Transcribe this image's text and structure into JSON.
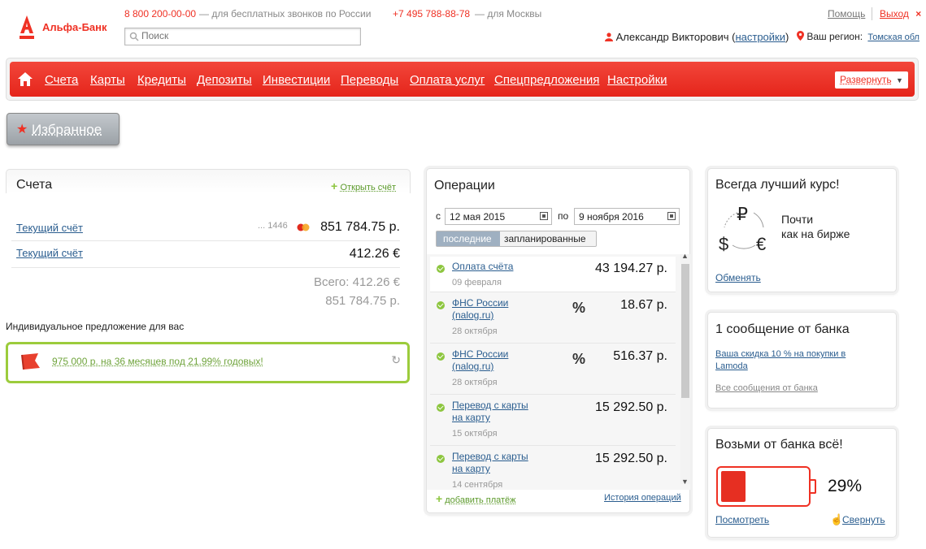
{
  "header": {
    "brand": "Альфа-Банк",
    "phone1": "8 800 200-00-00",
    "phone1_note": "— для бесплатных звонков по России",
    "phone2": "+7 495 788-88-78",
    "phone2_note": "— для Москвы",
    "search_placeholder": "Поиск",
    "help": "Помощь",
    "exit": "Выход",
    "user_name": "Александр Викторович",
    "settings_link": "настройки",
    "region_label": "Ваш регион:",
    "region_value": "Томская обл"
  },
  "nav": {
    "items": [
      "Счета",
      "Карты",
      "Кредиты",
      "Депозиты",
      "Инвестиции",
      "Переводы",
      "Оплата услуг",
      "Спецпредложения",
      "Настройки"
    ],
    "expand": "Развернуть"
  },
  "favorites": {
    "label": "Избранное"
  },
  "accounts": {
    "title": "Счета",
    "open_link": "Открыть счёт",
    "rows": [
      {
        "name": "Текущий счёт",
        "card_mask": "... 1446",
        "amount": "851 784.75 р."
      },
      {
        "name": "Текущий счёт",
        "card_mask": "",
        "amount": "412.26 €"
      }
    ],
    "total_label": "Всего: 412.26 €",
    "total_rub": "851 784.75 р.",
    "offer_heading": "Индивидуальное предложение для вас",
    "offer_text": "975 000 р. на 36 месяцев под 21.99% годовых!"
  },
  "operations": {
    "title": "Операции",
    "from_label": "с",
    "from_date": "12 мая 2015",
    "to_label": "по",
    "to_date": "9 ноября 2016",
    "tabs": [
      "последние",
      "запланированные"
    ],
    "items": [
      {
        "name": "Оплата счёта",
        "date": "09 февраля",
        "amount": "43 194.27 р.",
        "tax": false
      },
      {
        "name": "ФНС России (nalog.ru)",
        "date": "28 октября",
        "amount": "18.67 р.",
        "tax": true
      },
      {
        "name": "ФНС России (nalog.ru)",
        "date": "28 октября",
        "amount": "516.37 р.",
        "tax": true
      },
      {
        "name": "Перевод с карты на карту",
        "date": "15 октября",
        "amount": "15 292.50 р.",
        "tax": false
      },
      {
        "name": "Перевод с карты на карту",
        "date": "14 сентября",
        "amount": "15 292.50 р.",
        "tax": false
      }
    ],
    "add_payment": "добавить платёж",
    "history": "История операций"
  },
  "rate": {
    "title": "Всегда лучший курс!",
    "text_line1": "Почти",
    "text_line2": "как на бирже",
    "link": "Обменять",
    "currencies": [
      "₽",
      "$",
      "€"
    ]
  },
  "messages": {
    "title": "1 сообщение от банка",
    "message": "Ваша скидка 10 % на покупки в Lamoda",
    "all": "Все сообщения от банка"
  },
  "battery": {
    "title": "Возьми от банка всё!",
    "percent_text": "29%",
    "level": 0.29,
    "view": "Посмотреть",
    "collapse": "Свернуть"
  },
  "colors": {
    "brand": "#ef3124",
    "check": "#8dc63f",
    "offer_border": "#9ccc3c"
  }
}
